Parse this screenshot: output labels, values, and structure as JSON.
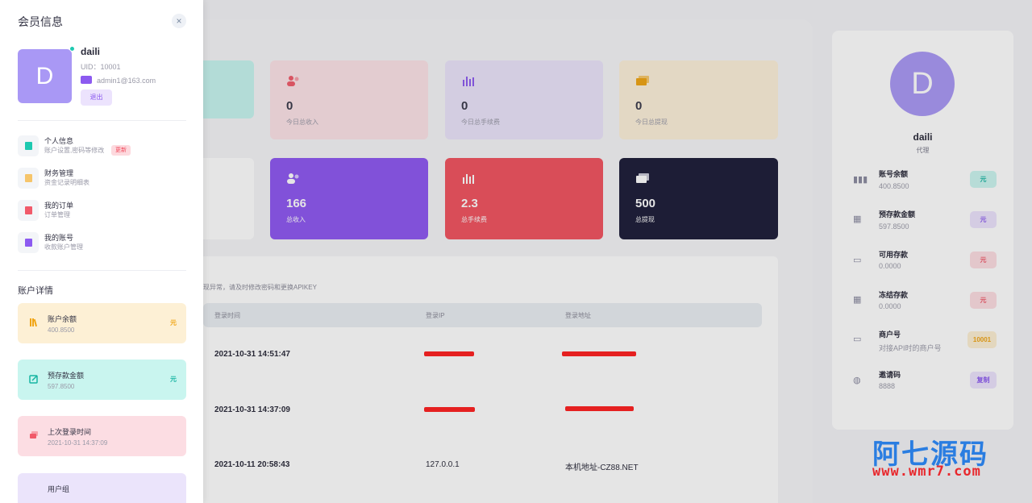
{
  "stats_top": [
    {
      "value": "",
      "label": ""
    },
    {
      "value": "0",
      "label": "今日总收入"
    },
    {
      "value": "0",
      "label": "今日总手续费"
    },
    {
      "value": "0",
      "label": "今日总提现"
    }
  ],
  "stats_bottom": [
    {
      "value": "",
      "label": ""
    },
    {
      "value": "166",
      "label": "总收入"
    },
    {
      "value": "2.3",
      "label": "总手续费"
    },
    {
      "value": "500",
      "label": "总提现"
    }
  ],
  "login_log": {
    "tip": "现异常，请及时修改密码和更换APIKEY",
    "headers": [
      "登录时间",
      "登录IP",
      "登录地址"
    ],
    "rows": [
      {
        "time": "2021-10-31 14:51:47",
        "ip": "",
        "addr": ""
      },
      {
        "time": "2021-10-31 14:37:09",
        "ip": "",
        "addr": ""
      },
      {
        "time": "2021-10-11 20:58:43",
        "ip": "127.0.0.1",
        "addr": "本机地址-CZ88.NET"
      }
    ]
  },
  "profile_panel": {
    "avatar_letter": "D",
    "name": "daili",
    "role": "代理",
    "items": [
      {
        "title": "账号余额",
        "value": "400.8500",
        "badge": "元"
      },
      {
        "title": "预存款金额",
        "value": "597.8500",
        "badge": "元"
      },
      {
        "title": "可用存款",
        "value": "0.0000",
        "badge": "元"
      },
      {
        "title": "冻结存款",
        "value": "0.0000",
        "badge": "元"
      },
      {
        "title": "商户号",
        "value": "对接API时的商户号",
        "badge": "10001"
      },
      {
        "title": "邀请码",
        "value": "8888",
        "badge": "复制"
      }
    ]
  },
  "drawer": {
    "title": "会员信息",
    "close_icon": "×",
    "avatar_letter": "D",
    "username": "daili",
    "uid": "UID：10001",
    "email": "admin1@163.com",
    "logout": "退出",
    "menu": [
      {
        "title": "个人信息",
        "sub": "账户设置,密码等修改",
        "badge": "更新"
      },
      {
        "title": "财务管理",
        "sub": "资金记录明细表"
      },
      {
        "title": "我的订单",
        "sub": "订单管理"
      },
      {
        "title": "我的账号",
        "sub": "收款账户管理"
      }
    ],
    "section_title": "账户详情",
    "accounts": [
      {
        "title": "账户余额",
        "value": "400.8500",
        "unit": "元"
      },
      {
        "title": "预存款金额",
        "value": "597.8500",
        "unit": "元"
      },
      {
        "title": "上次登录时间",
        "value": "2021-10-31 14:37:09"
      },
      {
        "title": "用户组"
      }
    ]
  },
  "watermark": {
    "cn": "阿七源码",
    "url_a": "www.",
    "url_b": "wmr7",
    "url_c": ".com"
  },
  "colors": {
    "accent": "#8c5af0",
    "teal": "#17b5a2",
    "red": "#f2525f",
    "navy": "#1c1c38",
    "warning": "#f0a413"
  }
}
